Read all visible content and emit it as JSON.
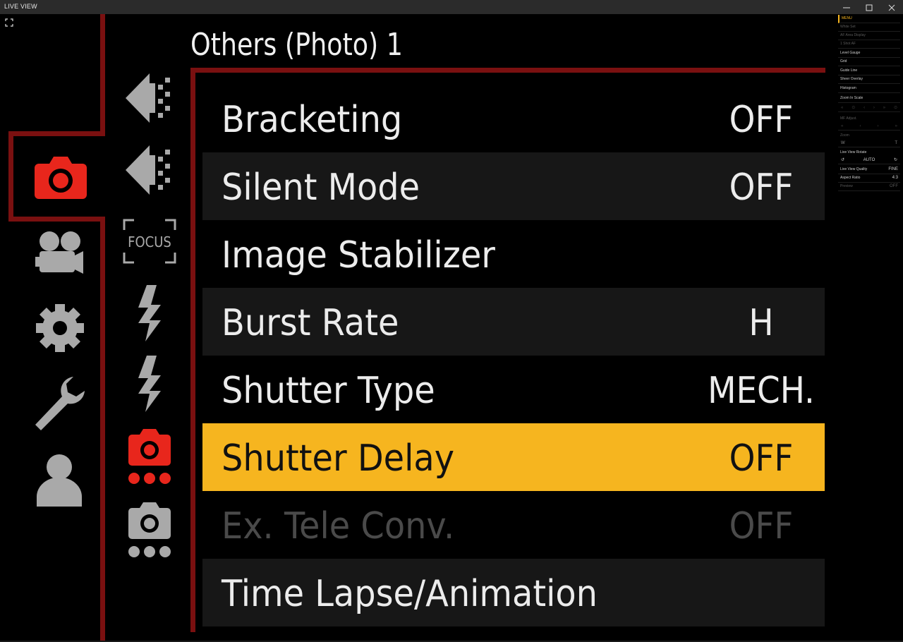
{
  "window": {
    "title": "LIVE VIEW",
    "minimize_label": "minimize",
    "maximize_label": "maximize",
    "close_label": "close"
  },
  "menu": {
    "title": "Others (Photo) 1",
    "items": [
      {
        "label": "Bracketing",
        "value": "OFF",
        "state": "normal"
      },
      {
        "label": "Silent Mode",
        "value": "OFF",
        "state": "normal"
      },
      {
        "label": "Image Stabilizer",
        "value": "",
        "state": "normal"
      },
      {
        "label": "Burst Rate",
        "value": "H",
        "state": "normal"
      },
      {
        "label": "Shutter Type",
        "value": "MECH.",
        "state": "normal"
      },
      {
        "label": "Shutter Delay",
        "value": "OFF",
        "state": "selected"
      },
      {
        "label": "Ex. Tele Conv.",
        "value": "OFF",
        "state": "disabled"
      },
      {
        "label": "Time Lapse/Animation",
        "value": "",
        "state": "normal"
      }
    ]
  },
  "categories": [
    {
      "icon": "camera-icon",
      "active": true
    },
    {
      "icon": "video-camera-icon",
      "active": false
    },
    {
      "icon": "gear-icon",
      "active": false
    },
    {
      "icon": "wrench-icon",
      "active": false
    },
    {
      "icon": "user-icon",
      "active": false
    }
  ],
  "subcategories": [
    {
      "icon": "photo-quality-icon",
      "text": ""
    },
    {
      "icon": "photo-quality-2-icon",
      "text": ""
    },
    {
      "icon": "focus-icon",
      "text": "FOCUS"
    },
    {
      "icon": "flash-icon",
      "text": ""
    },
    {
      "icon": "flash-2-icon",
      "text": ""
    },
    {
      "icon": "others-photo-1-icon",
      "text": ""
    },
    {
      "icon": "others-photo-2-icon",
      "text": ""
    }
  ],
  "side_panel": {
    "menu": "MENU",
    "white_set": "White Set",
    "af_area_display": "AF Area Display",
    "one_shot_af": "1 Shot AF",
    "level_gauge": "Level Gauge",
    "grid": "Grid",
    "guide_line": "Guide Line",
    "sheer_overlay": "Sheer Overlay",
    "histogram": "Histogram",
    "zoom_in_scale": "Zoom In Scale",
    "mf_adjust": "MF Adjust.",
    "zoom": "Zoom",
    "zoom_w": "W",
    "zoom_t": "T",
    "live_view_rotate": "Live View Rotate",
    "rotate_auto": "AUTO",
    "live_view_quality": "Live View Quality",
    "live_view_quality_value": "FINE",
    "aspect_ratio": "Aspect Ratio",
    "aspect_ratio_value": "4:3",
    "preview": "Preview",
    "preview_value": "OFF"
  },
  "colors": {
    "accent_red": "#7a1010",
    "selected_yellow": "#f6b51f",
    "active_icon_red": "#e8261c",
    "icon_gray": "#a9a9a9"
  }
}
